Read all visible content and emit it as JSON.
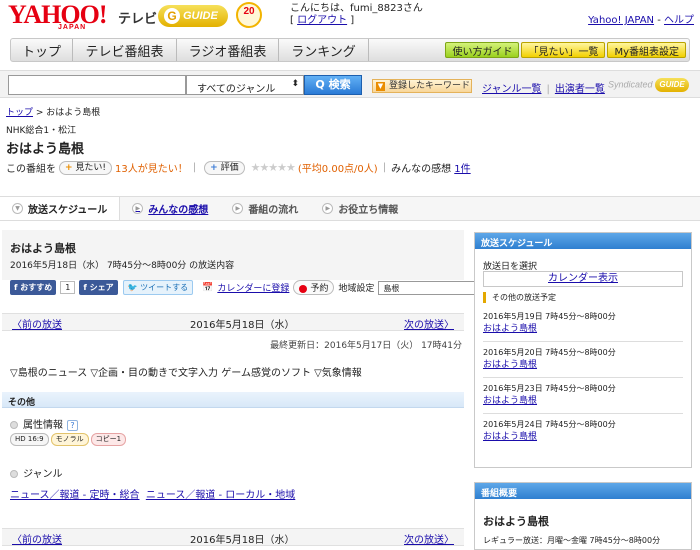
{
  "header": {
    "logo_text": "YAHOO!",
    "logo_sub": "JAPAN",
    "tv_label": "テレビ",
    "gguide_text": "GUIDE",
    "anniversary": "20",
    "greeting": "こんにちは、fumi_8823さん",
    "logout": "ログアウト",
    "yahoo_japan_link": "Yahoo! JAPAN",
    "help_link": "ヘルプ"
  },
  "nav": {
    "tabs": [
      "トップ",
      "テレビ番組表",
      "ラジオ番組表",
      "ランキング"
    ],
    "usage_guide": "使い方ガイド",
    "mitai_list": "「見たい」一覧",
    "my_settings": "My番組表設定"
  },
  "search": {
    "input_value": "",
    "genre_select": "すべてのジャンル",
    "search_button": "Q 検索",
    "keyword_button": "登録したキーワード",
    "genre_list_link": "ジャンル一覧",
    "performers_link": "出演者一覧",
    "syndicated": "Syndicated",
    "syn_guide": "GUIDE"
  },
  "breadcrumb": {
    "top": "トップ",
    "current": "おはよう島根"
  },
  "program": {
    "station": "NHK総合1・松江",
    "title": "おはよう島根",
    "this_program": "この番組を",
    "mitai_pill": "見たい!",
    "mitai_count": "13人が見たい！",
    "rating_pill": "評価",
    "stars": "★★★★★",
    "average": "(平均0.00点/0人)",
    "impressions_label": "みんなの感想",
    "impressions_count": "1件"
  },
  "tabs": [
    "放送スケジュール",
    "みんなの感想",
    "番組の流れ",
    "お役立ち情報"
  ],
  "main": {
    "title": "おはよう島根",
    "date_line": "2016年5月18日（水） 7時45分～8時00分  の放送内容",
    "fb_recommend": "おすすめ",
    "fb_count": "1",
    "fb_share": "シェア",
    "tweet": "ツイートする",
    "calendar_register": "カレンダーに登録",
    "reserve": "予約",
    "region_label": "地域設定",
    "region_value": "島根",
    "prev": "〈前の放送",
    "current_date": "2016年5月18日（水）",
    "next": "次の放送〉",
    "last_update": "最終更新日：2016年5月17日（火） 17時41分",
    "content": "▽島根のニュース ▽企画・目の動きで文字入力 ゲーム感覚のソフト ▽気象情報",
    "other_section": "その他",
    "attr_label": "属性情報",
    "attr_help": "?",
    "tags": [
      "HD 16:9",
      "モノラル",
      "コピー1"
    ],
    "genre_label": "ジャンル",
    "genre_links": [
      "ニュース／報道 - 定時・総合",
      "ニュース／報道 - ローカル・地域"
    ]
  },
  "side": {
    "schedule_header": "放送スケジュール",
    "select_date": "放送日を選択",
    "calendar_button": "カレンダー表示",
    "other_schedule": "その他の放送予定",
    "rows": [
      {
        "date": "2016年5月19日  7時45分～8時00分",
        "link": "おはよう島根"
      },
      {
        "date": "2016年5月20日  7時45分～8時00分",
        "link": "おはよう島根"
      },
      {
        "date": "2016年5月23日  7時45分～8時00分",
        "link": "おはよう島根"
      },
      {
        "date": "2016年5月24日  7時45分～8時00分",
        "link": "おはよう島根"
      }
    ],
    "overview_header": "番組概要",
    "overview_title": "おはよう島根",
    "regular": "レギュラー放送：月曜～金曜  7時45分～8時00分"
  }
}
